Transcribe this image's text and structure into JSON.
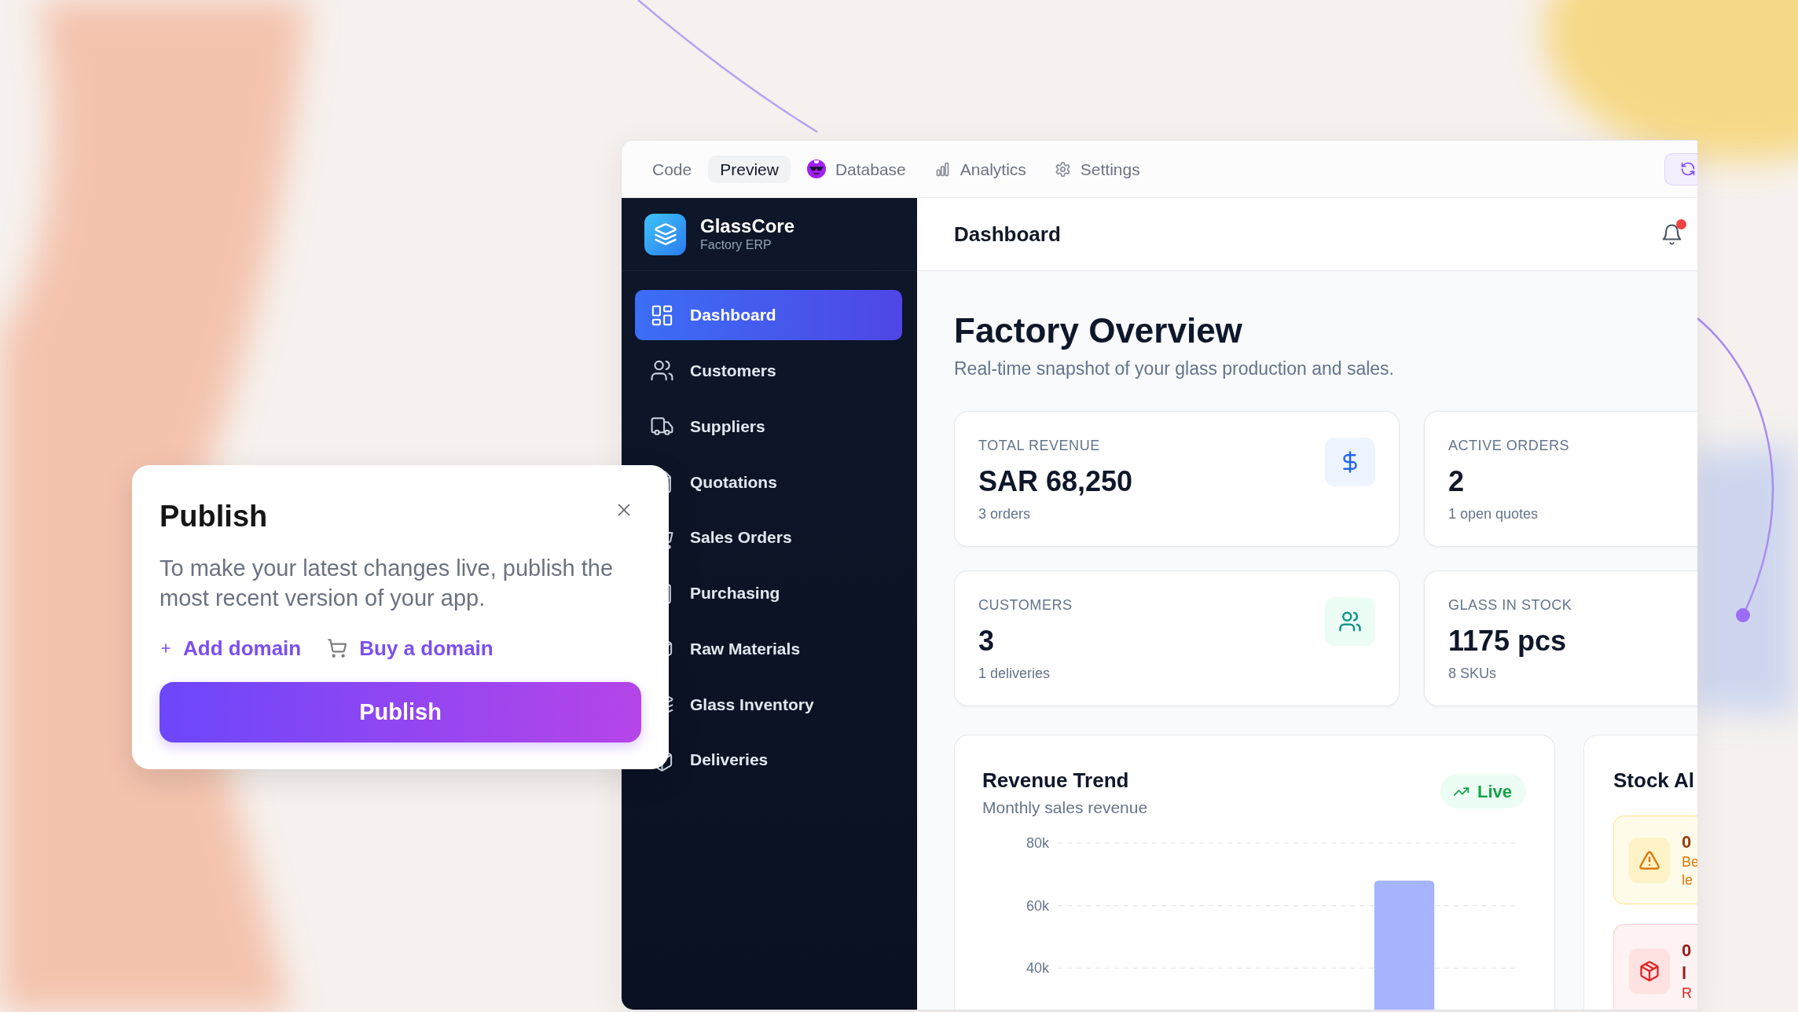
{
  "top_tabs": [
    {
      "label": "Code",
      "selected": false
    },
    {
      "label": "Preview",
      "selected": true
    },
    {
      "label": "Database",
      "selected": false
    },
    {
      "label": "Analytics",
      "selected": false
    },
    {
      "label": "Settings",
      "selected": false
    }
  ],
  "sidebar": {
    "brand": {
      "name": "GlassCore",
      "subtitle": "Factory ERP"
    },
    "items": [
      {
        "label": "Dashboard",
        "selected": true
      },
      {
        "label": "Customers",
        "selected": false
      },
      {
        "label": "Suppliers",
        "selected": false
      },
      {
        "label": "Quotations",
        "selected": false
      },
      {
        "label": "Sales Orders",
        "selected": false
      },
      {
        "label": "Purchasing",
        "selected": false
      },
      {
        "label": "Raw Materials",
        "selected": false
      },
      {
        "label": "Glass Inventory",
        "selected": false
      },
      {
        "label": "Deliveries",
        "selected": false
      }
    ]
  },
  "header": {
    "title": "Dashboard",
    "notification_dot": true
  },
  "overview": {
    "title": "Factory Overview",
    "subtitle": "Real-time snapshot of your glass production and sales."
  },
  "stats": [
    {
      "label": "TOTAL REVENUE",
      "value": "SAR 68,250",
      "note": "3 orders"
    },
    {
      "label": "ACTIVE ORDERS",
      "value": "2",
      "note": "1 open quotes"
    },
    {
      "label": "CUSTOMERS",
      "value": "3",
      "note": "1 deliveries"
    },
    {
      "label": "GLASS IN STOCK",
      "value": "1175 pcs",
      "note": "8 SKUs"
    }
  ],
  "revenue_trend": {
    "title": "Revenue Trend",
    "subtitle": "Monthly sales revenue",
    "badge": "Live",
    "chart_data": {
      "type": "bar",
      "values": [
        null,
        null,
        null,
        null,
        68000,
        null
      ],
      "ylim": [
        26000,
        80000
      ],
      "yticks": [
        {
          "value": 40000,
          "label": "40k"
        },
        {
          "value": 60000,
          "label": "60k"
        },
        {
          "value": 80000,
          "label": "80k"
        }
      ],
      "grid": true
    }
  },
  "stock_alerts": {
    "title": "Stock Al",
    "items": [
      {
        "kind": "warning",
        "title_lines": [
          "0"
        ],
        "description_lines": [
          "Be",
          "le"
        ]
      },
      {
        "kind": "danger",
        "title_lines": [
          "0",
          "l"
        ],
        "description_lines": [
          "R"
        ]
      }
    ]
  },
  "publish_dialog": {
    "title": "Publish",
    "description": "To make your latest changes live, publish the most recent version of your app.",
    "links": [
      "Add domain",
      "Buy a domain"
    ],
    "button": "Publish"
  }
}
